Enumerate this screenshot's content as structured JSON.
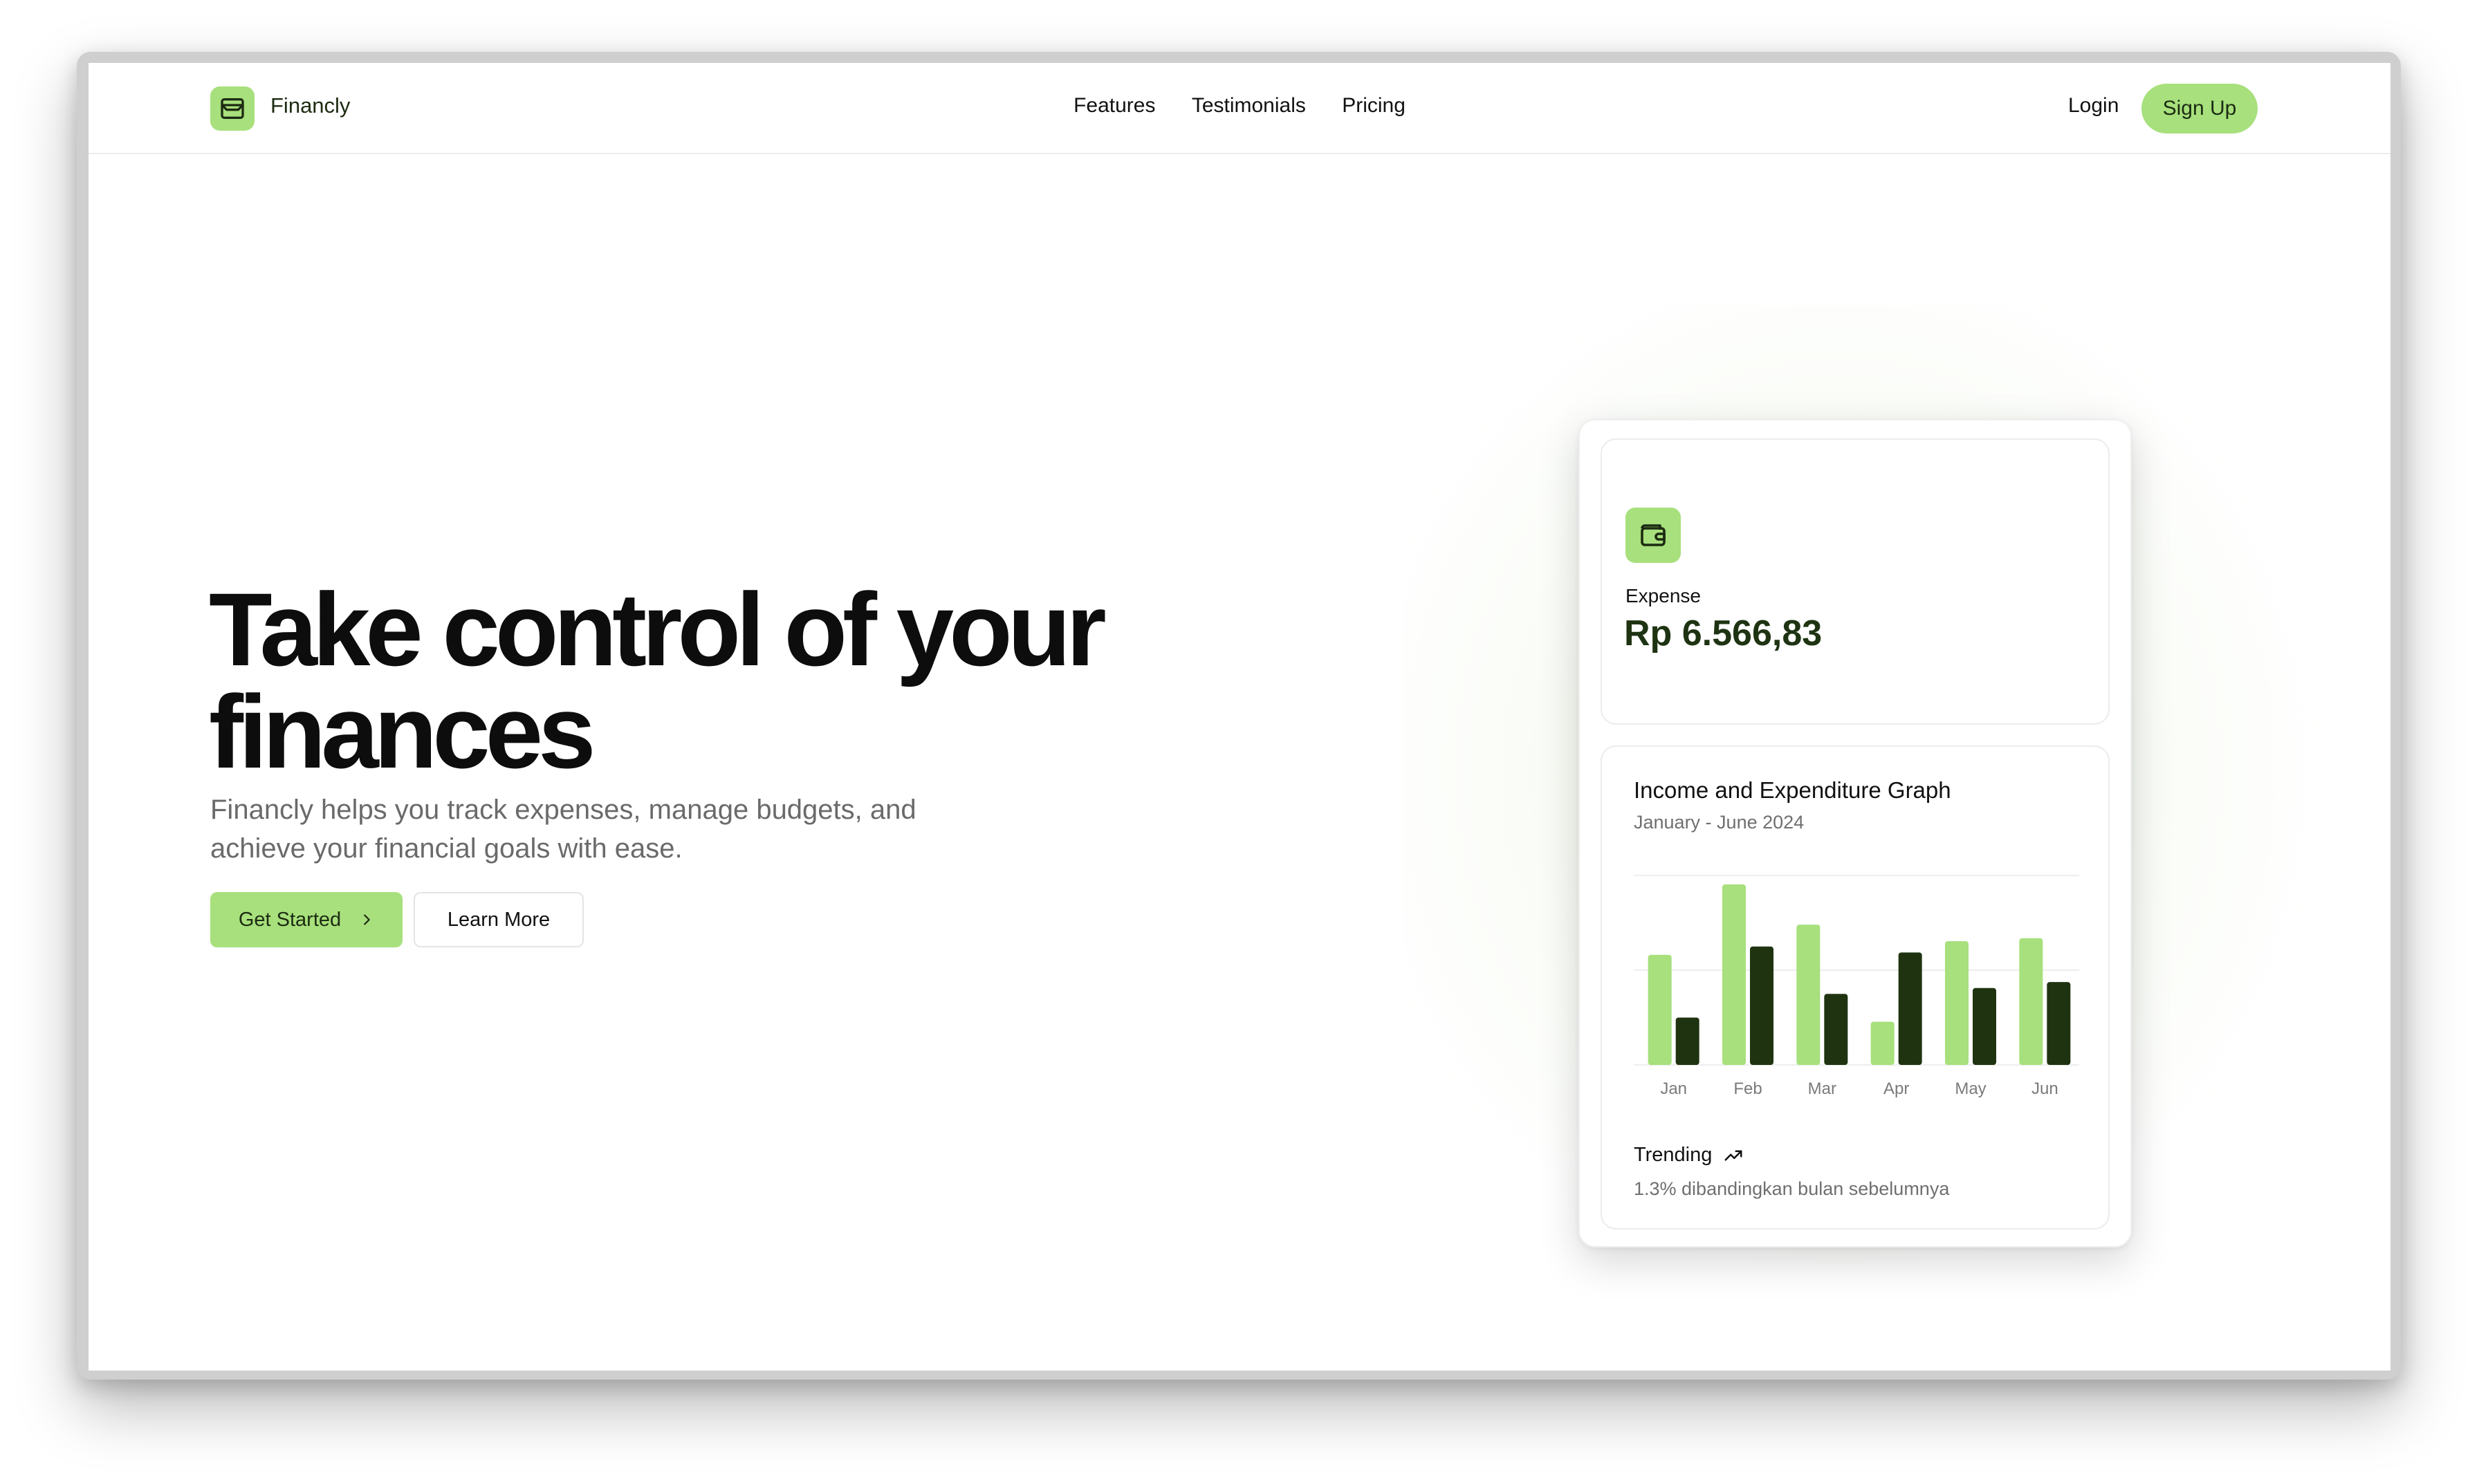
{
  "brand": {
    "name": "Financly",
    "accent": "#a7e07c",
    "dark": "#1e3312"
  },
  "nav": {
    "links": [
      "Features",
      "Testimonials",
      "Pricing"
    ],
    "login": "Login",
    "signup": "Sign Up"
  },
  "hero": {
    "title_line1": "Take control of your",
    "title_line2": "finances",
    "subtitle_line1": "Financly helps you track expenses, manage budgets, and",
    "subtitle_line2": "achieve your financial goals with ease.",
    "primary_button": "Get Started",
    "secondary_button": "Learn More"
  },
  "card": {
    "expense_label": "Expense",
    "expense_value": "Rp 6.566,83",
    "graph_title": "Income and Expenditure Graph",
    "graph_subtitle": "January - June 2024",
    "trend_label": "Trending",
    "trend_note": "1.3% dibandingkan bulan sebelumnya"
  },
  "icons": {
    "logo": "wallet-icon",
    "card": "wallet-icon",
    "get_started": "chevron-right-icon",
    "trend": "trending-up-icon"
  },
  "chart_data": {
    "type": "bar",
    "categories": [
      "Jan",
      "Feb",
      "Mar",
      "Apr",
      "May",
      "Jun"
    ],
    "series": [
      {
        "values": [
          186,
          305,
          237,
          73,
          209,
          214
        ],
        "color": "#a7e07c"
      },
      {
        "values": [
          80,
          200,
          120,
          190,
          130,
          140
        ],
        "color": "#1f3310"
      }
    ],
    "ylim": [
      0,
      320
    ],
    "grid": true,
    "legend": "none"
  }
}
